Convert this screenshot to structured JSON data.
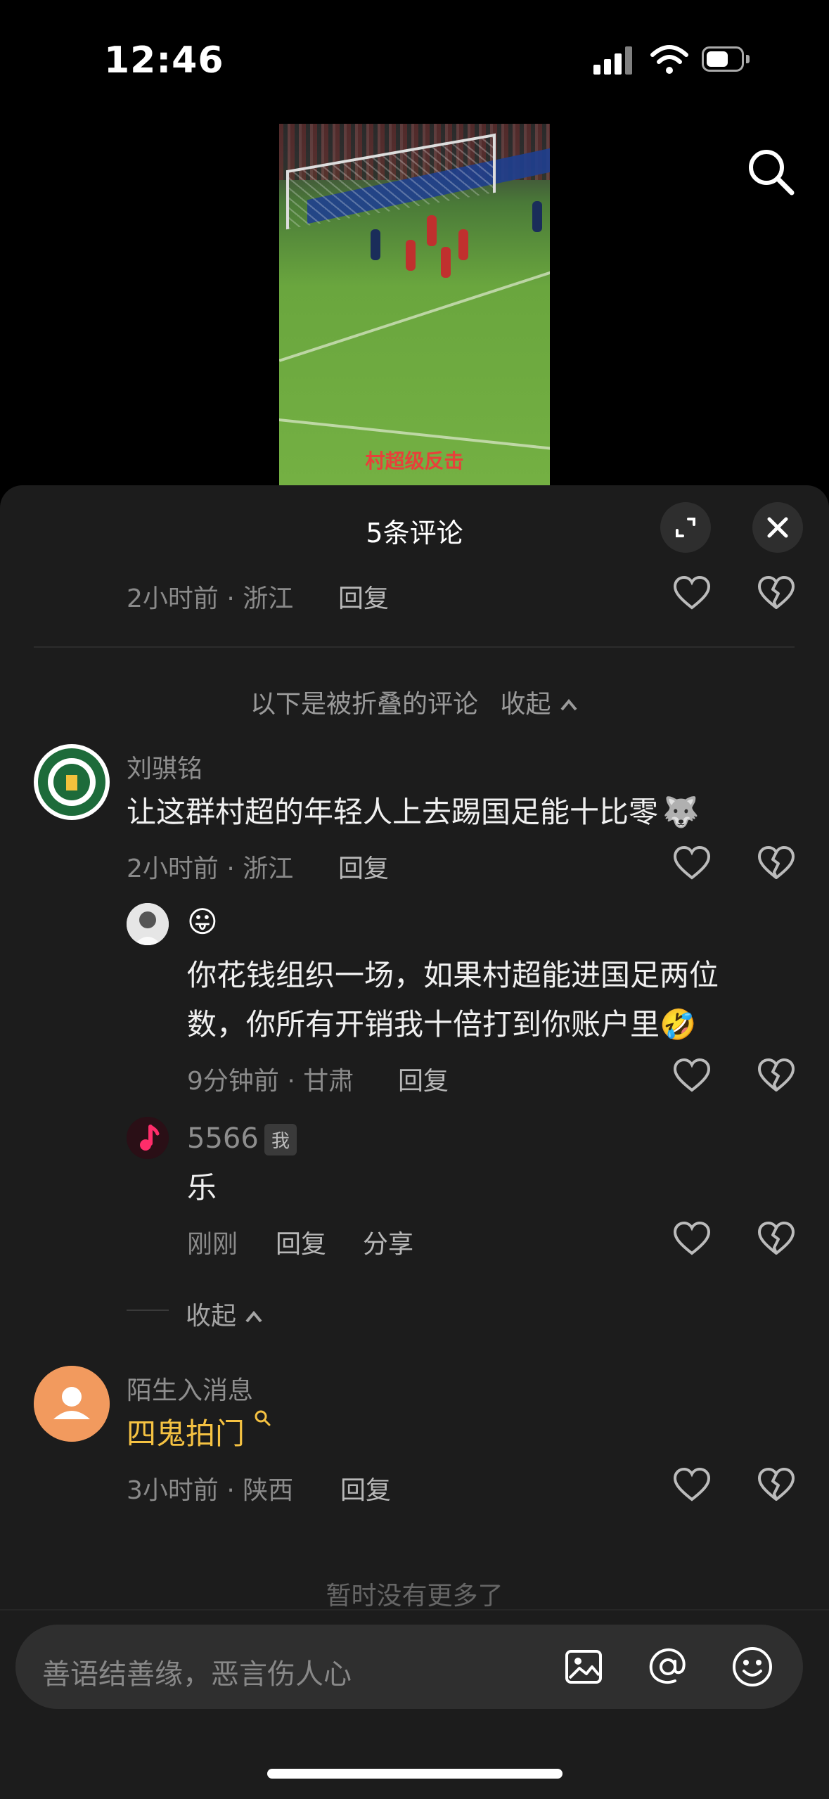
{
  "status_bar": {
    "time": "12:46"
  },
  "video": {
    "caption": "村超级反击"
  },
  "sheet": {
    "title": "5条评论",
    "top_comment_meta": {
      "time_location": "2小时前 · 浙江",
      "reply": "回复"
    },
    "folded_label": "以下是被折叠的评论",
    "folded_collapse": "收起"
  },
  "comments": [
    {
      "username": "刘骐铭",
      "text": "让这群村超的年轻人上去踢国足能十比零",
      "time_location": "2小时前 · 浙江",
      "reply": "回复",
      "replies": [
        {
          "emoji": "😛",
          "text_line1": "你花钱组织一场，如果村超能进国足两位",
          "text_line2": "数，你所有开销我十倍打到你账户里",
          "time_location": "9分钟前 · 甘肃",
          "reply": "回复"
        },
        {
          "username": "5566",
          "me_tag": "我",
          "text": "乐",
          "time": "刚刚",
          "reply": "回复",
          "share": "分享"
        }
      ],
      "collapse": "收起"
    },
    {
      "username": "陌生入消息",
      "text": "四鬼拍门",
      "time_location": "3小时前 · 陕西",
      "reply": "回复"
    }
  ],
  "no_more": "暂时没有更多了",
  "input": {
    "placeholder": "善语结善缘，恶言伤人心"
  },
  "colors": {
    "highlight_text": "#f5c242",
    "background": "#1c1c1c"
  }
}
